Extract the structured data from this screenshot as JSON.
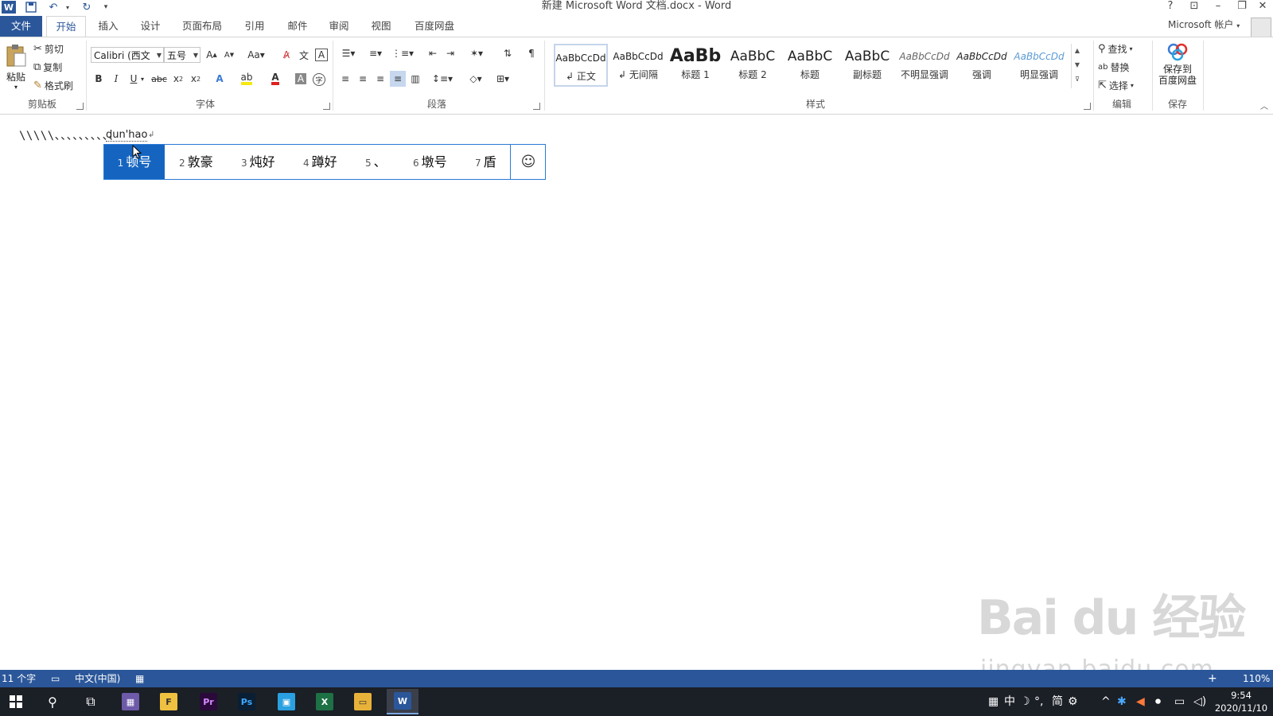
{
  "window": {
    "title": "新建 Microsoft Word 文档.docx - Word",
    "controls": [
      "?",
      "⊡",
      "–",
      "❐",
      "✕"
    ]
  },
  "tabs": [
    "文件",
    "开始",
    "插入",
    "设计",
    "页面布局",
    "引用",
    "邮件",
    "审阅",
    "视图",
    "百度网盘"
  ],
  "account": "Microsoft 帐户",
  "ribbon": {
    "clipboard": {
      "paste": "粘贴",
      "cut": "剪切",
      "copy": "复制",
      "painter": "格式刷",
      "label": "剪贴板"
    },
    "font": {
      "name": "Calibri (西文",
      "size": "五号",
      "label": "字体"
    },
    "paragraph": {
      "label": "段落"
    },
    "styles": {
      "label": "样式",
      "items": [
        {
          "sample": "AaBbCcDd",
          "name": "正文"
        },
        {
          "sample": "AaBbCcDd",
          "name": "无间隔"
        },
        {
          "sample": "AaBb",
          "name": "标题 1"
        },
        {
          "sample": "AaBbC",
          "name": "标题 2"
        },
        {
          "sample": "AaBbC",
          "name": "标题"
        },
        {
          "sample": "AaBbC",
          "name": "副标题"
        },
        {
          "sample": "AaBbCcDd",
          "name": "不明显强调"
        },
        {
          "sample": "AaBbCcDd",
          "name": "强调"
        },
        {
          "sample": "AaBbCcDd",
          "name": "明显强调"
        }
      ]
    },
    "editing": {
      "find": "查找",
      "replace": "替换",
      "select": "选择",
      "label": "编辑"
    },
    "save": {
      "line1": "保存到",
      "line2": "百度网盘",
      "label": "保存"
    }
  },
  "document": {
    "typed_text": "\\\\\\\\\\、、、、、、、、、、",
    "composition": "dun'hao"
  },
  "ime": {
    "candidates": [
      {
        "num": "1",
        "text": "顿号"
      },
      {
        "num": "2",
        "text": "敦豪"
      },
      {
        "num": "3",
        "text": "炖好"
      },
      {
        "num": "4",
        "text": "蹲好"
      },
      {
        "num": "5",
        "text": "、"
      },
      {
        "num": "6",
        "text": "墩号"
      },
      {
        "num": "7",
        "text": "盾"
      }
    ],
    "emoji": "☺"
  },
  "statusbar": {
    "words": "11 个字",
    "language": "中文(中国)",
    "zoom": "110%"
  },
  "taskbar": {
    "tray_ime": "中",
    "tray_simplified": "简",
    "time": "9:54",
    "date": "2020/11/10"
  },
  "watermark": {
    "logo": "Bai du 经验",
    "url": "jingyan.baidu.com"
  },
  "colors": {
    "word_blue": "#2b579a",
    "ime_select": "#1565c0",
    "taskbar": "#1b1f26"
  }
}
